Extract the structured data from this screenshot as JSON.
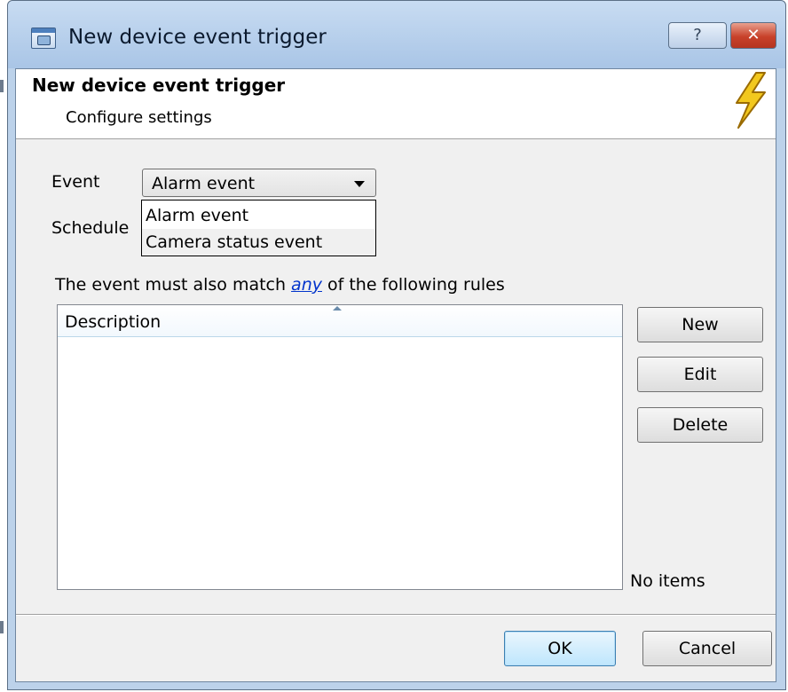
{
  "window": {
    "title": "New device event trigger",
    "help_label": "?",
    "close_label": "✕"
  },
  "header": {
    "title": "New device event trigger",
    "subtitle": "Configure settings"
  },
  "form": {
    "event_label": "Event",
    "event_value": "Alarm event",
    "schedule_label": "Schedule",
    "dropdown_options": [
      "Alarm event",
      "Camera status event"
    ]
  },
  "rules": {
    "text_before": "The event must also match",
    "match_link": "any",
    "text_after": "of the following rules",
    "column_description": "Description",
    "empty_text": "No items"
  },
  "buttons": {
    "new": "New",
    "edit": "Edit",
    "delete": "Delete",
    "ok": "OK",
    "cancel": "Cancel"
  },
  "colors": {
    "link": "#0033cc",
    "title_bar": "#bcd2ea",
    "close_button": "#c8412a",
    "bolt": "#f2c81e"
  }
}
